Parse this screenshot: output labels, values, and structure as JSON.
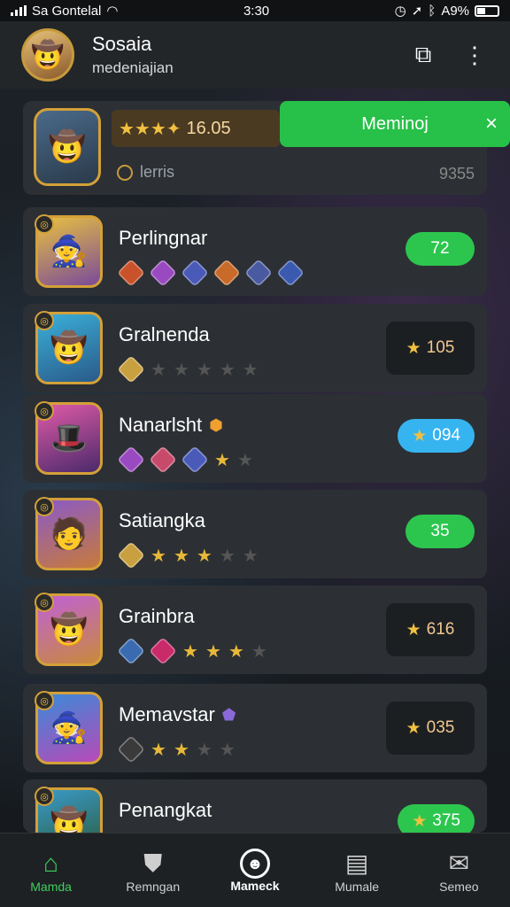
{
  "status": {
    "carrier": "Sa Gontelal",
    "time": "3:30",
    "battery": "A9%"
  },
  "header": {
    "title": "Sosaia",
    "subtitle": "medeniajian"
  },
  "featured": {
    "rating": "16.05",
    "button_label": "Meminoj",
    "close": "×",
    "sub_label": "lerris",
    "count": "9355"
  },
  "players": [
    {
      "name": "Perlingnar",
      "value": "72",
      "style": "green",
      "colors": [
        "#c9522a",
        "#9a4ac0",
        "#4a5ab8",
        "#c86a2a",
        "#4a5aa0",
        "#3a5ab0"
      ],
      "stars_on": 0,
      "stars_off": 0
    },
    {
      "name": "Gralnenda",
      "value": "105",
      "style": "dark",
      "colors": [
        "#c9a040"
      ],
      "stars_on": 0,
      "stars_off": 5
    },
    {
      "name": "Nanarlsht",
      "value": "094",
      "style": "blue",
      "colors": [
        "#9a4ac0",
        "#c84a6a",
        "#4a5ab8"
      ],
      "stars_on": 1,
      "stars_off": 1
    },
    {
      "name": "Satiangka",
      "value": "35",
      "style": "green",
      "colors": [
        "#c9a040"
      ],
      "stars_on": 3,
      "stars_off": 2
    },
    {
      "name": "Grainbra",
      "value": "616",
      "style": "dark",
      "colors": [
        "#3a6ab0",
        "#c82a6a"
      ],
      "stars_on": 3,
      "stars_off": 1
    },
    {
      "name": "Memavstar",
      "value": "035",
      "style": "dark",
      "colors": [
        "#3a3a3a"
      ],
      "stars_on": 2,
      "stars_off": 2
    },
    {
      "name": "Penangkat",
      "value": "375",
      "style": "green",
      "colors": [],
      "stars_on": 0,
      "stars_off": 0
    }
  ],
  "tabs": [
    "Mamda",
    "Remngan",
    "Mameck",
    "Mumale",
    "Semeo"
  ]
}
